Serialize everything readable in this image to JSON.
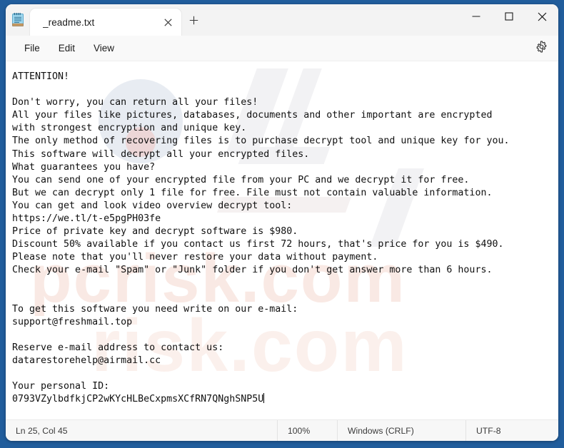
{
  "window": {
    "app_name": "Notepad",
    "app_icon": "notepad-icon",
    "controls": {
      "minimize": "minimize-icon",
      "maximize": "maximize-icon",
      "close": "close-icon"
    },
    "desktop_background_color": "#215d9c"
  },
  "tabbar": {
    "tabs": [
      {
        "title": "_readme.txt",
        "active": true,
        "close_icon": "close-icon"
      }
    ],
    "new_tab_label": "+",
    "new_tab_icon": "plus-icon"
  },
  "menubar": {
    "items": [
      {
        "label": "File"
      },
      {
        "label": "Edit"
      },
      {
        "label": "View"
      }
    ],
    "settings_icon": "gear-icon"
  },
  "editor": {
    "content": "ATTENTION!\n\nDon't worry, you can return all your files!\nAll your files like pictures, databases, documents and other important are encrypted\nwith strongest encryption and unique key.\nThe only method of recovering files is to purchase decrypt tool and unique key for you.\nThis software will decrypt all your encrypted files.\nWhat guarantees you have?\nYou can send one of your encrypted file from your PC and we decrypt it for free.\nBut we can decrypt only 1 file for free. File must not contain valuable information.\nYou can get and look video overview decrypt tool:\nhttps://we.tl/t-e5pgPH03fe\nPrice of private key and decrypt software is $980.\nDiscount 50% available if you contact us first 72 hours, that's price for you is $490.\nPlease note that you'll never restore your data without payment.\nCheck your e-mail \"Spam\" or \"Junk\" folder if you don't get answer more than 6 hours.\n\n\nTo get this software you need write on our e-mail:\nsupport@freshmail.top\n\nReserve e-mail address to contact us:\ndatarestorehelp@airmail.cc\n\nYour personal ID:\n0793VZylbdfkjCP2wKYcHLBeCxpmsXCfRN7QNghSNP5U",
    "watermark_text": "pcrisk.com"
  },
  "statusbar": {
    "position": "Ln 25, Col 45",
    "zoom": "100%",
    "line_ending": "Windows (CRLF)",
    "encoding": "UTF-8"
  }
}
